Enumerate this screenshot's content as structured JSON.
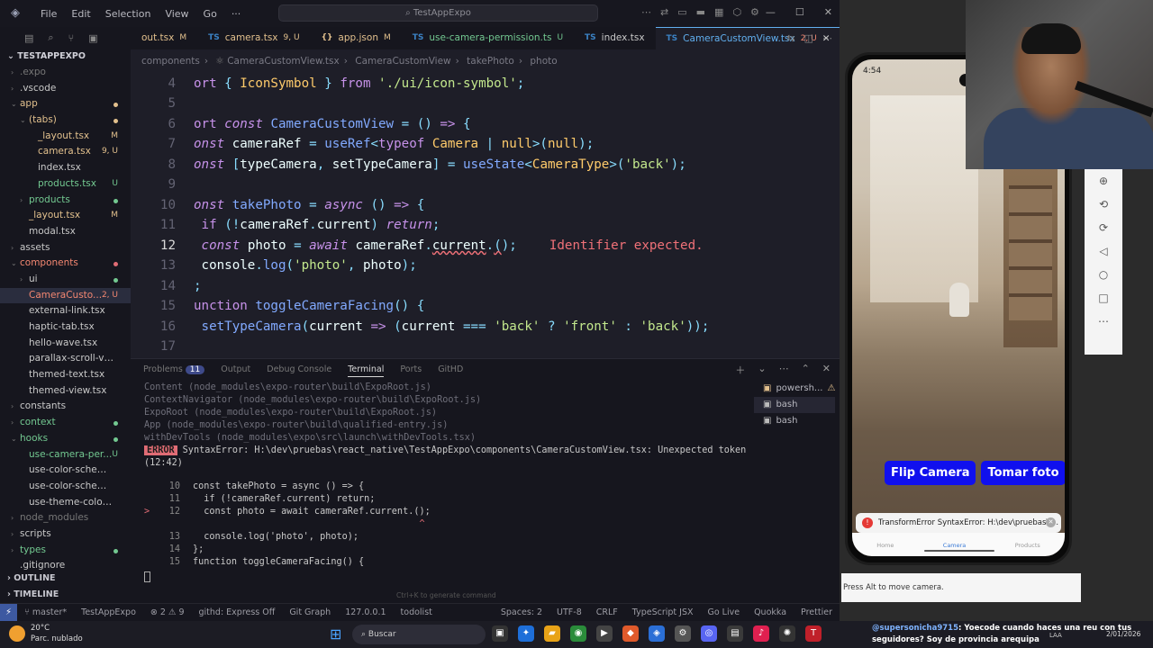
{
  "titlebar": {
    "menus": [
      "File",
      "Edit",
      "Selection",
      "View",
      "Go",
      "···"
    ],
    "search": "TestAppExpo"
  },
  "sidebar": {
    "project": "TESTAPPEXPO",
    "items": [
      {
        "label": ".expo",
        "type": "folder",
        "indent": 1,
        "color": "dim"
      },
      {
        "label": ".vscode",
        "type": "folder",
        "indent": 1,
        "color": "dir"
      },
      {
        "label": "app",
        "type": "folder-open",
        "indent": 1,
        "color": "mod",
        "dot": "#e2c08d"
      },
      {
        "label": "(tabs)",
        "type": "folder-open",
        "indent": 2,
        "color": "mod",
        "dot": "#e2c08d"
      },
      {
        "label": "_layout.tsx",
        "type": "file",
        "indent": 3,
        "color": "mod",
        "badge": "M"
      },
      {
        "label": "camera.tsx",
        "type": "file",
        "indent": 3,
        "color": "mod",
        "badge": "9, U"
      },
      {
        "label": "index.tsx",
        "type": "file",
        "indent": 3,
        "color": "dir"
      },
      {
        "label": "products.tsx",
        "type": "file",
        "indent": 3,
        "color": "unt",
        "badge": "U"
      },
      {
        "label": "products",
        "type": "folder",
        "indent": 2,
        "color": "unt",
        "dot": "#73c991"
      },
      {
        "label": "_layout.tsx",
        "type": "file",
        "indent": 2,
        "color": "mod",
        "badge": "M"
      },
      {
        "label": "modal.tsx",
        "type": "file",
        "indent": 2,
        "color": "dir"
      },
      {
        "label": "assets",
        "type": "folder",
        "indent": 1,
        "color": "dir"
      },
      {
        "label": "components",
        "type": "folder-open",
        "indent": 1,
        "color": "err",
        "dot": "#e06c75"
      },
      {
        "label": "ui",
        "type": "folder",
        "indent": 2,
        "color": "dir",
        "dot": "#73c991"
      },
      {
        "label": "CameraCusto...",
        "type": "file",
        "indent": 2,
        "color": "err",
        "badge": "2, U",
        "selected": true
      },
      {
        "label": "external-link.tsx",
        "type": "file",
        "indent": 2,
        "color": "dir"
      },
      {
        "label": "haptic-tab.tsx",
        "type": "file",
        "indent": 2,
        "color": "dir"
      },
      {
        "label": "hello-wave.tsx",
        "type": "file",
        "indent": 2,
        "color": "dir"
      },
      {
        "label": "parallax-scroll-view.tsx",
        "type": "file",
        "indent": 2,
        "color": "dir"
      },
      {
        "label": "themed-text.tsx",
        "type": "file",
        "indent": 2,
        "color": "dir"
      },
      {
        "label": "themed-view.tsx",
        "type": "file",
        "indent": 2,
        "color": "dir"
      },
      {
        "label": "constants",
        "type": "folder",
        "indent": 1,
        "color": "dir"
      },
      {
        "label": "context",
        "type": "folder",
        "indent": 1,
        "color": "unt",
        "dot": "#73c991"
      },
      {
        "label": "hooks",
        "type": "folder-open",
        "indent": 1,
        "color": "unt",
        "dot": "#73c991"
      },
      {
        "label": "use-camera-per...",
        "type": "file",
        "indent": 2,
        "color": "unt",
        "badge": "U"
      },
      {
        "label": "use-color-scheme.ts",
        "type": "file",
        "indent": 2,
        "color": "dir"
      },
      {
        "label": "use-color-scheme.we...",
        "type": "file",
        "indent": 2,
        "color": "dir"
      },
      {
        "label": "use-theme-color.ts",
        "type": "file",
        "indent": 2,
        "color": "dir"
      },
      {
        "label": "node_modules",
        "type": "folder",
        "indent": 1,
        "color": "dim"
      },
      {
        "label": "scripts",
        "type": "folder",
        "indent": 1,
        "color": "dir"
      },
      {
        "label": "types",
        "type": "folder",
        "indent": 1,
        "color": "unt",
        "dot": "#73c991"
      },
      {
        "label": ".gitignore",
        "type": "file",
        "indent": 1,
        "color": "dir"
      }
    ],
    "outline": "OUTLINE",
    "timeline": "TIMELINE"
  },
  "tabs": [
    {
      "label": "out.tsx",
      "badge": "M",
      "icon": "",
      "color": "mod"
    },
    {
      "label": "camera.tsx",
      "badge": "9, U",
      "icon": "TS",
      "color": "mod"
    },
    {
      "label": "app.json",
      "badge": "M",
      "icon": "{}",
      "color": "mod"
    },
    {
      "label": "use-camera-permission.ts",
      "badge": "U",
      "icon": "TS",
      "color": "unt"
    },
    {
      "label": "index.tsx",
      "badge": "",
      "icon": "TS",
      "color": "dir"
    },
    {
      "label": "CameraCustomView.tsx",
      "badge": "2, U",
      "icon": "TS",
      "color": "active",
      "active": true
    }
  ],
  "breadcrumb": [
    "components",
    "CameraCustomView.tsx",
    "CameraCustomView",
    "takePhoto",
    "photo"
  ],
  "editor": {
    "error_message": "Identifier expected."
  },
  "panel": {
    "tabs": [
      "Problems",
      "Output",
      "Debug Console",
      "Terminal",
      "Ports",
      "GitHD"
    ],
    "problems_count": "11",
    "stack": [
      "Content (node_modules\\expo-router\\build\\ExpoRoot.js)",
      "ContextNavigator (node_modules\\expo-router\\build\\ExpoRoot.js)",
      "ExpoRoot (node_modules\\expo-router\\build\\ExpoRoot.js)",
      "App (node_modules\\expo-router\\build\\qualified-entry.js)",
      "withDevTools (node_modules\\expo\\src\\launch\\withDevTools.tsx)"
    ],
    "error_badge": "ERROR",
    "error_text": "SyntaxError: H:\\dev\\pruebas\\react_native\\TestAppExpo\\components\\CameraCustomView.tsx: Unexpected token",
    "error_pos": "(12:42)",
    "snippet": [
      {
        "n": "10",
        "marker": "",
        "code": "const takePhoto = async () => {"
      },
      {
        "n": "11",
        "marker": "",
        "code": "  if (!cameraRef.current) return;"
      },
      {
        "n": "12",
        "marker": ">",
        "code": "  const photo = await cameraRef.current.();"
      },
      {
        "n": "",
        "marker": "",
        "code": "                                         ^"
      },
      {
        "n": "13",
        "marker": "",
        "code": "  console.log('photo', photo);"
      },
      {
        "n": "14",
        "marker": "",
        "code": "};"
      },
      {
        "n": "15",
        "marker": "",
        "code": "function toggleCameraFacing() {"
      }
    ],
    "terminals": [
      {
        "label": "powersh...",
        "warn": true
      },
      {
        "label": "bash",
        "selected": true
      },
      {
        "label": "bash"
      }
    ],
    "hint": "Ctrl+K to generate command"
  },
  "statusbar": {
    "branch": "master*",
    "project": "TestAppExpo",
    "problems": "⊗ 2 ⚠ 9",
    "githd": "githd: Express Off",
    "gitgraph": "Git Graph",
    "server": "127.0.0.1",
    "todo": "todolist",
    "spaces": "Spaces: 2",
    "encoding": "UTF-8",
    "eol": "CRLF",
    "lang": "TypeScript JSX",
    "golive": "Go Live",
    "quokka": "Quokka",
    "prettier": "Prettier"
  },
  "phone": {
    "time": "4:54",
    "flip_button": "Flip Camera",
    "photo_button": "Tomar foto",
    "toast": "TransformError SyntaxError: H:\\dev\\pruebas\\r...",
    "bottom_tabs": [
      "Home",
      "Camera",
      "Products"
    ],
    "move_hint": "Press Alt to move camera."
  },
  "taskbar": {
    "temperature": "20°C",
    "weather": "Parc. nublado",
    "search": "Buscar",
    "chat_user": "@supersonicha9715",
    "chat_text": ": Yoecode cuando haces una reu con tus seguidores? Soy de provincia arequipa",
    "lang": "LAA",
    "date": "2/01/2026"
  },
  "colors": {
    "accent": "#61afef",
    "error": "#f07178",
    "button_blue": "#1010ee"
  }
}
